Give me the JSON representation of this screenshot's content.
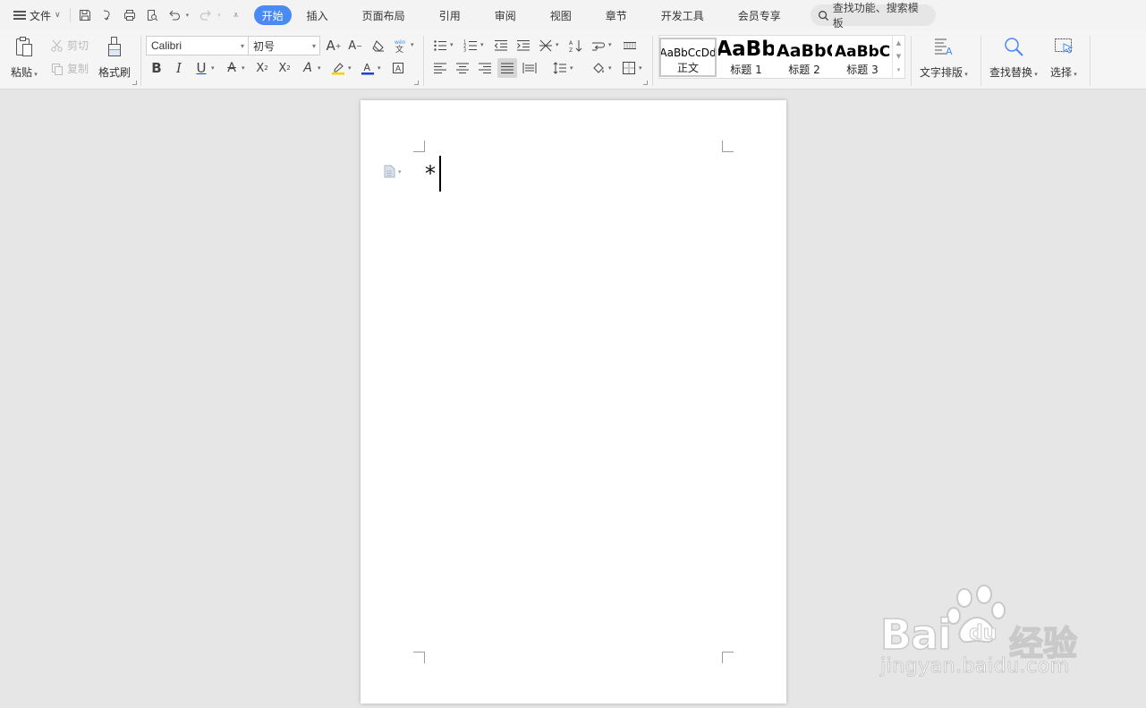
{
  "menubar": {
    "file_label": "文件",
    "tabs": [
      {
        "label": "开始",
        "active": true
      },
      {
        "label": "插入"
      },
      {
        "label": "页面布局"
      },
      {
        "label": "引用"
      },
      {
        "label": "审阅"
      },
      {
        "label": "视图"
      },
      {
        "label": "章节"
      },
      {
        "label": "开发工具"
      },
      {
        "label": "会员专享"
      }
    ],
    "search_placeholder": "查找功能、搜索模板",
    "accent_color": "#4a8af4"
  },
  "ribbon": {
    "clipboard": {
      "paste_label": "粘贴",
      "cut_label": "剪切",
      "copy_label": "复制",
      "format_painter_label": "格式刷"
    },
    "font": {
      "font_name": "Calibri",
      "font_size": "初号",
      "font_color": "#1f3fd8",
      "highlight_color": "#f2d200"
    },
    "styles": {
      "items": [
        {
          "preview": "AaBbCcDd",
          "name": "正文",
          "selected": true
        },
        {
          "preview": "AaBb",
          "name": "标题 1"
        },
        {
          "preview": "AaBbC",
          "name": "标题 2"
        },
        {
          "preview": "AaBbCc",
          "name": "标题 3"
        }
      ]
    },
    "text_layout_label": "文字排版",
    "find_replace_label": "查找替换",
    "select_label": "选择"
  },
  "document": {
    "text": "*"
  },
  "watermark": {
    "brand_left": "Bai",
    "brand_right": "经验",
    "url": "jingyan.baidu.com"
  }
}
